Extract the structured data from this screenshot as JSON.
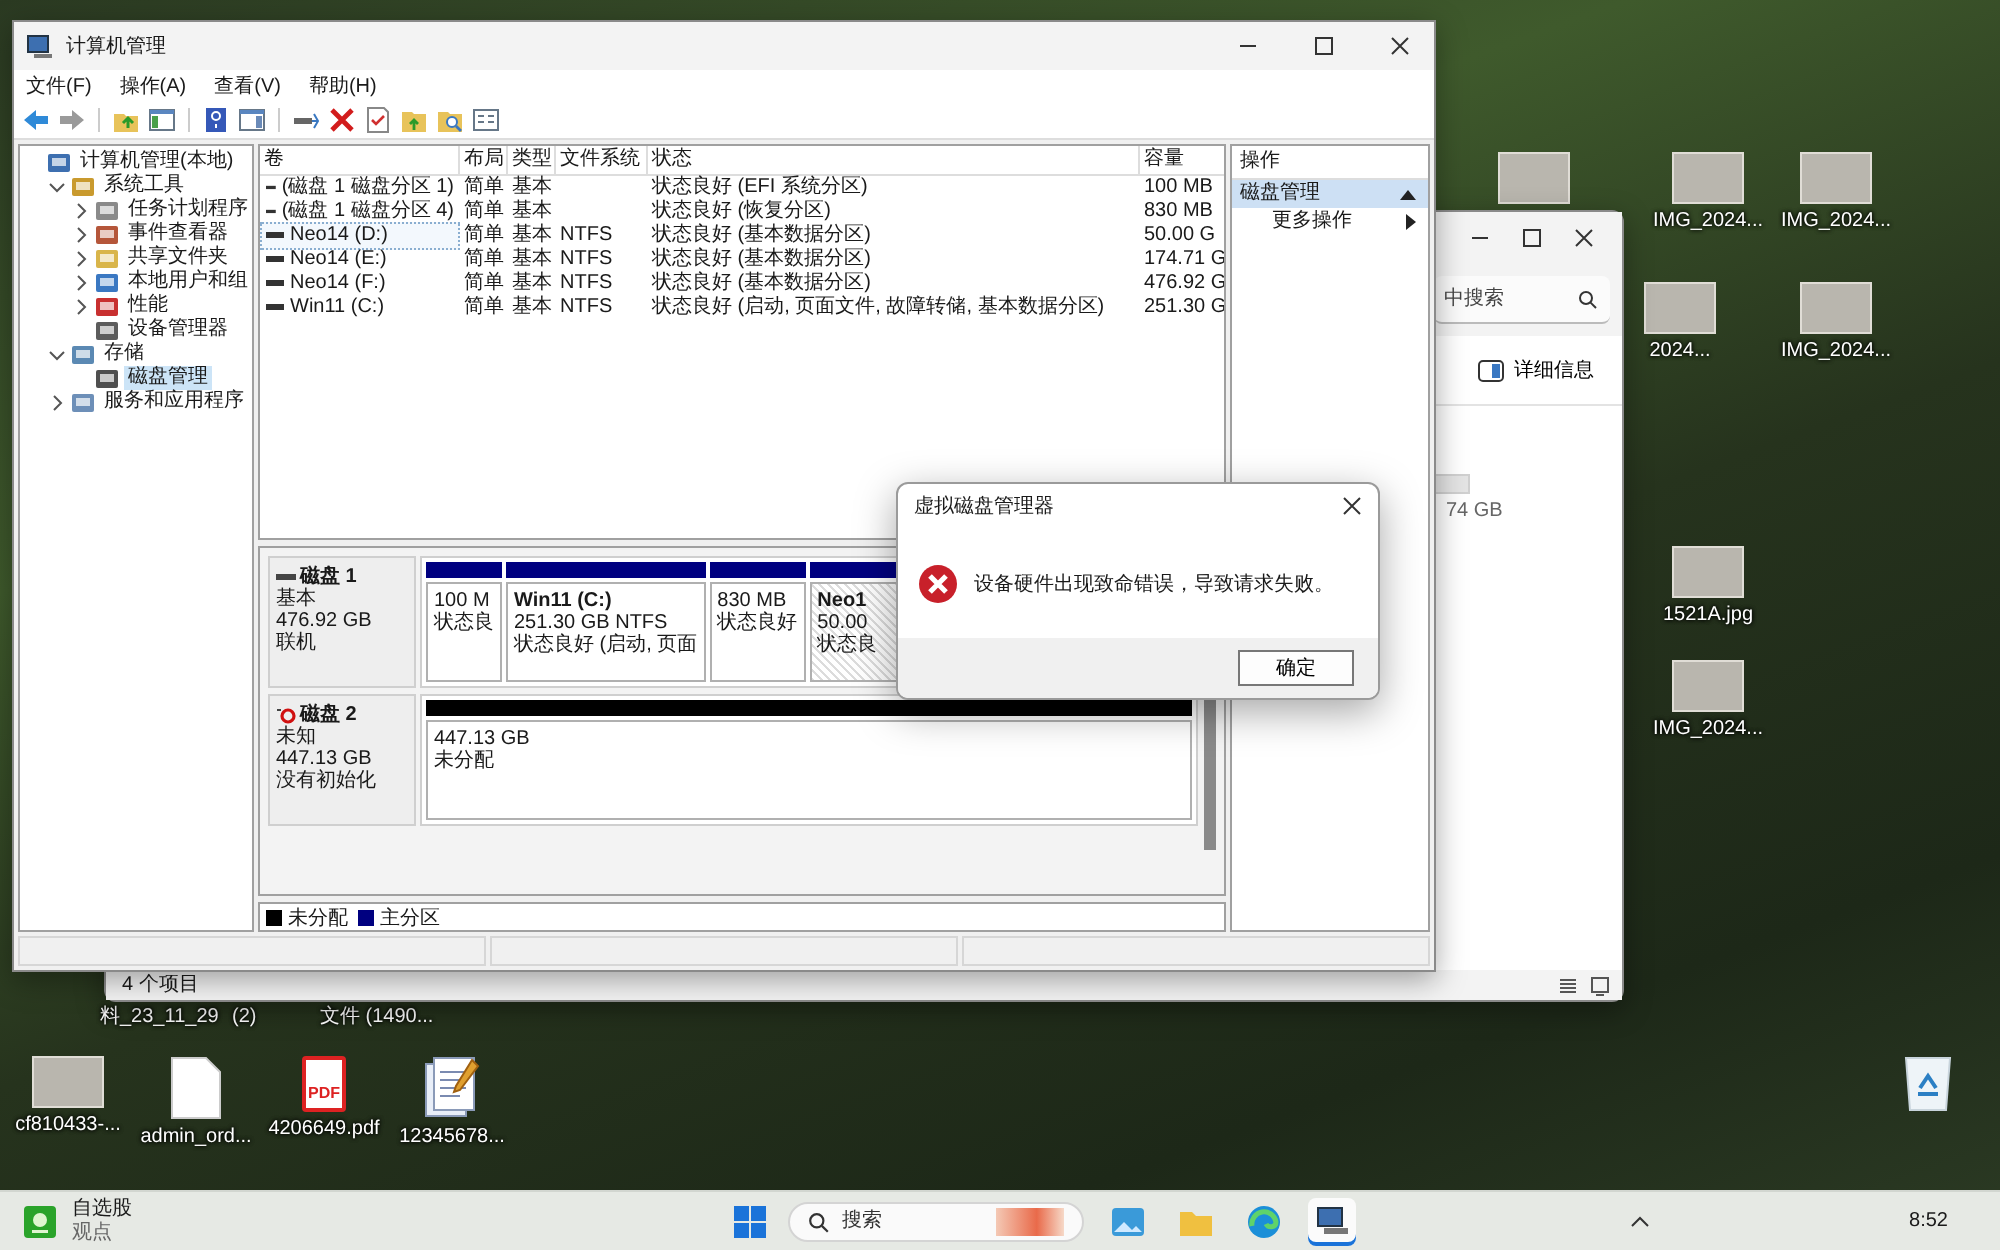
{
  "desktop": {
    "hidden_icon_labels": [
      "料_23_11_29",
      "(2)",
      "文件 (1490..."
    ],
    "bottom_icons": [
      {
        "kind": "photo",
        "label": "cf810433-..."
      },
      {
        "kind": "document",
        "label": "admin_ord..."
      },
      {
        "kind": "pdf",
        "label": "4206649.pdf",
        "icon_text": "PDF"
      },
      {
        "kind": "notes",
        "label": "12345678..."
      }
    ],
    "right_icons": [
      {
        "kind": "photo"
      },
      {
        "kind": "photo",
        "label": "IMG_2024..."
      },
      {
        "kind": "photo",
        "label": "IMG_2024..."
      },
      {
        "kind": "photo",
        "label": "2024..."
      },
      {
        "kind": "photo",
        "label": "IMG_2024..."
      },
      {
        "kind": "photo",
        "label": "1521A.jpg"
      },
      {
        "kind": "photo",
        "label": "IMG_2024..."
      },
      {
        "kind": "recycle"
      }
    ]
  },
  "explorer": {
    "search": {
      "placeholder": "中搜索"
    },
    "details_button": "详细信息",
    "drive_size": "74 GB",
    "status": "4 个项目"
  },
  "computer_management": {
    "title": "计算机管理",
    "menu": [
      "文件(F)",
      "操作(A)",
      "查看(V)",
      "帮助(H)"
    ],
    "tree": [
      {
        "label": "计算机管理(本地)",
        "kind": "computer",
        "selected": false,
        "children": [
          {
            "label": "系统工具",
            "kind": "tools",
            "expanded": true,
            "selected": false,
            "children": [
              {
                "label": "任务计划程序",
                "kind": "clock",
                "expanded": false,
                "selected": false
              },
              {
                "label": "事件查看器",
                "kind": "event",
                "expanded": false,
                "selected": false
              },
              {
                "label": "共享文件夹",
                "kind": "share",
                "expanded": false,
                "selected": false
              },
              {
                "label": "本地用户和组",
                "kind": "users",
                "expanded": false,
                "selected": false
              },
              {
                "label": "性能",
                "kind": "perf",
                "expanded": false,
                "selected": false
              },
              {
                "label": "设备管理器",
                "kind": "device",
                "selected": false
              }
            ]
          },
          {
            "label": "存储",
            "kind": "storage",
            "expanded": true,
            "selected": false,
            "children": [
              {
                "label": "磁盘管理",
                "kind": "disk",
                "selected": true
              }
            ]
          },
          {
            "label": "服务和应用程序",
            "kind": "services",
            "expanded": false,
            "selected": false
          }
        ]
      }
    ],
    "columns": [
      "卷",
      "布局",
      "类型",
      "文件系统",
      "状态",
      "容量"
    ],
    "rows": [
      {
        "volume": "(磁盘 1 磁盘分区 1)",
        "layout": "简单",
        "type": "基本",
        "status": "状态良好 (EFI 系统分区)",
        "capacity": "100 MB",
        "selected": false
      },
      {
        "volume": "(磁盘 1 磁盘分区 4)",
        "layout": "简单",
        "type": "基本",
        "status": "状态良好 (恢复分区)",
        "capacity": "830 MB",
        "selected": false
      },
      {
        "volume": "Neo14 (D:)",
        "layout": "简单",
        "type": "基本",
        "file_system": "NTFS",
        "status": "状态良好 (基本数据分区)",
        "capacity": "50.00 G",
        "selected": true
      },
      {
        "volume": "Neo14 (E:)",
        "layout": "简单",
        "type": "基本",
        "file_system": "NTFS",
        "status": "状态良好 (基本数据分区)",
        "capacity": "174.71 G",
        "selected": false
      },
      {
        "volume": "Neo14 (F:)",
        "layout": "简单",
        "type": "基本",
        "file_system": "NTFS",
        "status": "状态良好 (基本数据分区)",
        "capacity": "476.92 G",
        "selected": false
      },
      {
        "volume": "Win11 (C:)",
        "layout": "简单",
        "type": "基本",
        "file_system": "NTFS",
        "status": "状态良好 (启动, 页面文件, 故障转储, 基本数据分区)",
        "capacity": "251.30 G",
        "selected": false
      }
    ],
    "disks": [
      {
        "name": "磁盘 1",
        "kind": "online",
        "lines": [
          "基本",
          "476.92 GB",
          "联机"
        ],
        "partitions": [
          {
            "kind": "primary",
            "lines": [
              "100 M",
              "状态良"
            ],
            "selected": false
          },
          {
            "kind": "primary",
            "title": "Win11 (C:)",
            "lines": [
              "251.30 GB NTFS",
              "状态良好 (启动, 页面"
            ],
            "selected": false
          },
          {
            "kind": "primary",
            "lines": [
              "830 MB",
              "状态良好"
            ],
            "selected": false
          },
          {
            "kind": "primary",
            "title": "Neo1",
            "lines": [
              "50.00",
              "状态良"
            ],
            "selected": true
          }
        ]
      },
      {
        "name": "磁盘 2",
        "kind": "not_initialized",
        "lines": [
          "未知",
          "447.13 GB",
          "没有初始化"
        ],
        "partitions": [
          {
            "kind": "unallocated",
            "lines": [
              "447.13 GB",
              "未分配"
            ],
            "selected": false
          }
        ]
      }
    ],
    "legend": [
      {
        "label": "未分配",
        "color": "#000000"
      },
      {
        "label": "主分区",
        "color": "#000080"
      }
    ],
    "actions": {
      "header": "操作",
      "group": {
        "label": "磁盘管理",
        "expanded": true
      },
      "items": [
        "更多操作"
      ]
    }
  },
  "dialog": {
    "title": "虚拟磁盘管理器",
    "message": "设备硬件出现致命错误，导致请求失败。",
    "button": "确定"
  },
  "taskbar": {
    "widget": {
      "title": "自选股",
      "subtitle": "观点"
    },
    "search": {
      "placeholder": "搜索"
    },
    "apps": [
      {
        "kind": "photos",
        "active": false
      },
      {
        "kind": "folder",
        "active": false
      },
      {
        "kind": "browser",
        "active": false
      },
      {
        "kind": "computer",
        "active": true
      }
    ],
    "time": "8:52"
  }
}
